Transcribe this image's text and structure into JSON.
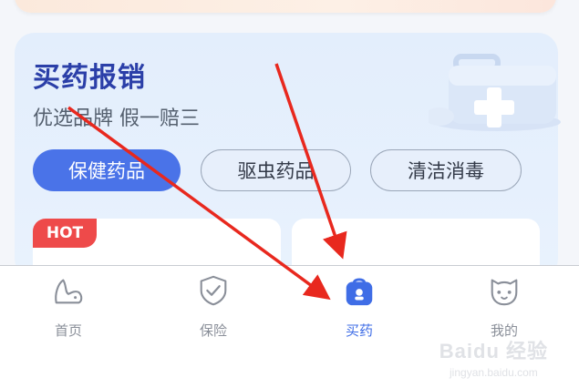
{
  "card": {
    "title": "买药报销",
    "subtitle": "优选品牌 假一赔三"
  },
  "category_tabs": [
    {
      "label": "保健药品",
      "active": true
    },
    {
      "label": "驱虫药品",
      "active": false
    },
    {
      "label": "清洁消毒",
      "active": false
    }
  ],
  "product_badge": "HOT",
  "nav": {
    "items": [
      {
        "label": "首页",
        "icon": "pet-home-icon",
        "active": false
      },
      {
        "label": "保险",
        "icon": "shield-check-icon",
        "active": false
      },
      {
        "label": "买药",
        "icon": "medicine-bag-icon",
        "active": true
      },
      {
        "label": "我的",
        "icon": "cat-face-icon",
        "active": false
      }
    ]
  },
  "watermark": {
    "main": "Baidu 经验",
    "sub": "jingyan.baidu.com"
  },
  "colors": {
    "accent": "#4a73e8",
    "active_nav": "#3f6de6",
    "hot_badge": "#ee4a4a",
    "arrow": "#e8281e",
    "title": "#2b3fa8"
  }
}
